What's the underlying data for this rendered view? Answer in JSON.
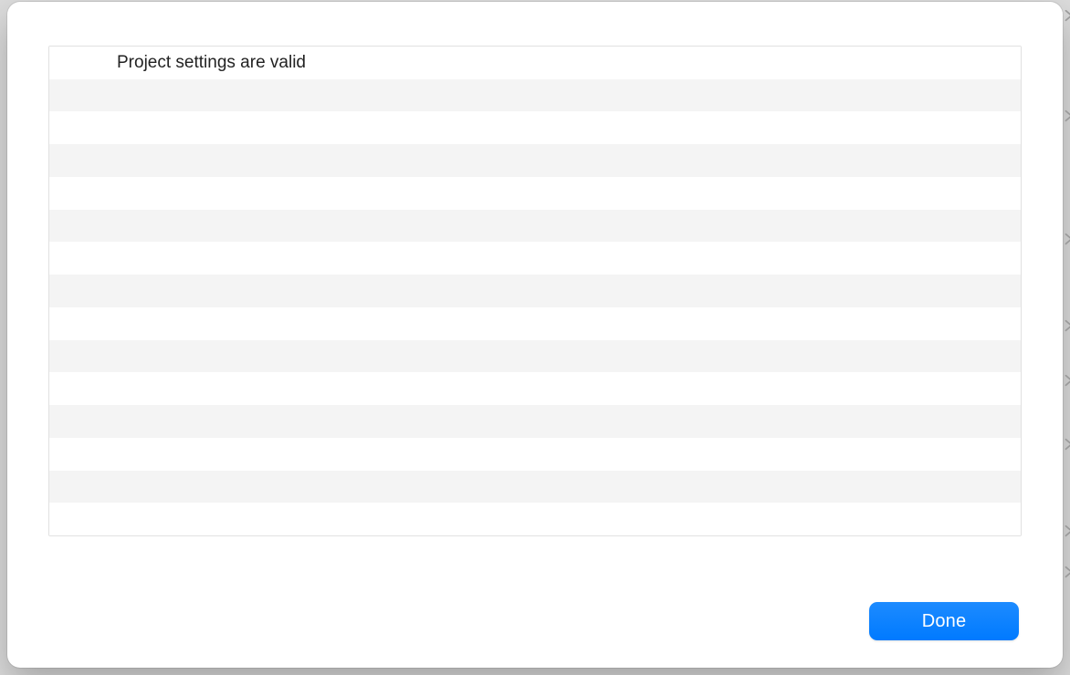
{
  "list": {
    "rows": [
      {
        "text": "Project settings are valid",
        "icon": ""
      },
      {
        "text": ""
      },
      {
        "text": ""
      },
      {
        "text": ""
      },
      {
        "text": ""
      },
      {
        "text": ""
      },
      {
        "text": ""
      },
      {
        "text": ""
      },
      {
        "text": ""
      },
      {
        "text": ""
      },
      {
        "text": ""
      },
      {
        "text": ""
      },
      {
        "text": ""
      },
      {
        "text": ""
      },
      {
        "text": ""
      }
    ]
  },
  "footer": {
    "done_label": "Done"
  },
  "colors": {
    "accent": "#007aff",
    "row_alt": "#f4f4f4",
    "border": "#e1e1e1"
  }
}
